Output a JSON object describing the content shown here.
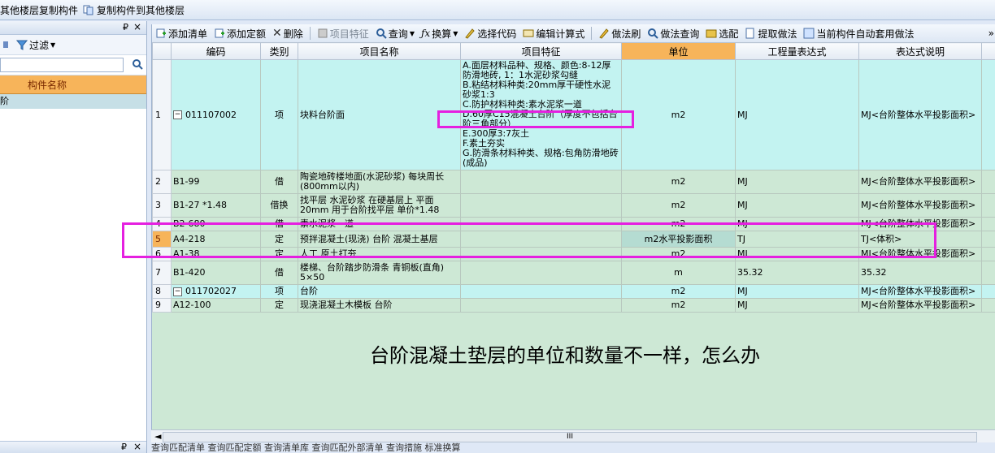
{
  "topbar": {
    "copy_from_other_floor": "其他楼层复制构件",
    "copy_to_other_floor": "复制构件到其他楼层"
  },
  "leftpanel": {
    "filter_label": "过滤",
    "header": "构件名称",
    "row_text": "阶",
    "search_placeholder": ""
  },
  "toolbar": {
    "add_list": "添加清单",
    "add_quota": "添加定额",
    "delete": "删除",
    "item_feature": "项目特征",
    "query": "查询",
    "convert": "换算",
    "select_code": "选择代码",
    "edit_formula": "编辑计算式",
    "method_brush": "做法刷",
    "method_query": "做法查询",
    "select_match": "选配",
    "extract_method": "提取做法",
    "auto_apply": "当前构件自动套用做法",
    "more": "»"
  },
  "columns": [
    "编码",
    "类别",
    "项目名称",
    "项目特征",
    "单位",
    "工程量表达式",
    "表达式说明"
  ],
  "rows": [
    {
      "no": "1",
      "code": "011107002",
      "type": "项",
      "name": "块料台阶面",
      "feature": "A.面层材料品种、规格、颜色:8-12厚防滑地砖, 1：1水泥砂浆勾缝\nB.粘结材料种类:20mm厚干硬性水泥砂浆1:3\nC.防护材料种类:素水泥浆一道\nD.60厚C15混凝土台阶（厚度不包括台阶三角部分）\nE.300厚3:7灰土\nF.素土夯实\nG.防滑条材料种类、规格:包角防滑地砖(成品)",
      "unit": "m2",
      "expr": "MJ",
      "desc": "MJ<台阶整体水平投影面积>"
    },
    {
      "no": "2",
      "code": "B1-99",
      "type": "借",
      "name": "陶瓷地砖楼地面(水泥砂浆) 每块周长(800mm以内)",
      "feature": "",
      "unit": "m2",
      "expr": "MJ",
      "desc": "MJ<台阶整体水平投影面积>"
    },
    {
      "no": "3",
      "code": "B1-27 *1.48",
      "type": "借换",
      "name": "找平层 水泥砂浆 在硬基层上 平面 20mm 用于台阶找平层 单价*1.48",
      "feature": "",
      "unit": "m2",
      "expr": "MJ",
      "desc": "MJ<台阶整体水平投影面积>"
    },
    {
      "no": "4",
      "code": "B2-680",
      "type": "借",
      "name": "素水泥浆一道",
      "feature": "",
      "unit": "m2",
      "expr": "MJ",
      "desc": "MJ<台阶整体水平投影面积>"
    },
    {
      "no": "5",
      "code": "A4-218",
      "type": "定",
      "name": "预拌混凝土(现浇) 台阶 混凝土基层",
      "feature": "",
      "unit": "m2水平投影面积",
      "expr": "TJ",
      "desc": "TJ<体积>"
    },
    {
      "no": "6",
      "code": "A1-38",
      "type": "定",
      "name": "人工 原土打夯",
      "feature": "",
      "unit": "m2",
      "expr": "MJ",
      "desc": "MJ<台阶整体水平投影面积>"
    },
    {
      "no": "7",
      "code": "B1-420",
      "type": "借",
      "name": "楼梯、台阶踏步防滑条 青铜板(直角) 5×50",
      "feature": "",
      "unit": "m",
      "expr": "35.32",
      "desc": "35.32"
    },
    {
      "no": "8",
      "code": "011702027",
      "type": "项",
      "name": "台阶",
      "feature": "",
      "unit": "m2",
      "expr": "MJ",
      "desc": "MJ<台阶整体水平投影面积>"
    },
    {
      "no": "9",
      "code": "A12-100",
      "type": "定",
      "name": "现浇混凝土木模板 台阶",
      "feature": "",
      "unit": "m2",
      "expr": "MJ",
      "desc": "MJ<台阶整体水平投影面积>"
    }
  ],
  "annotation": "台阶混凝土垫层的单位和数量不一样，怎么办",
  "statusbar": "查询匹配清单  查询匹配定额  查询清单库  查询匹配外部清单  查询措施           标准换算",
  "scroll_thumb": "III",
  "colors": {
    "accent_orange": "#f7b45a",
    "list_row": "#c3f3f1",
    "quota_row": "#cde8d5",
    "annotation_box": "#e520e0"
  }
}
